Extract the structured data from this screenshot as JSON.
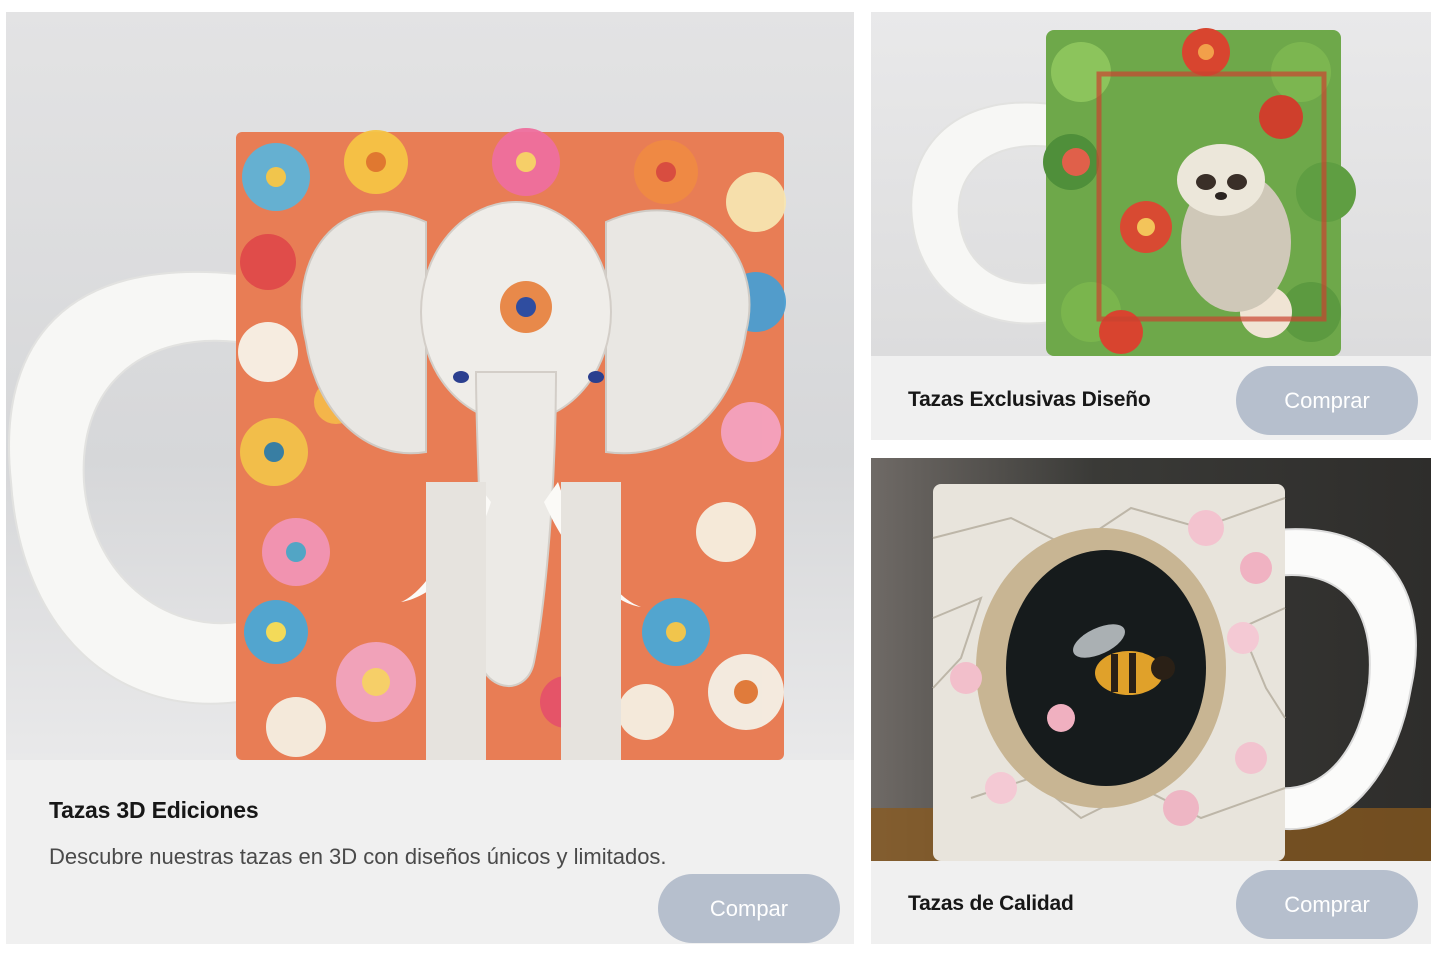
{
  "products": [
    {
      "title": "Tazas 3D Ediciones",
      "description": "Descubre nuestras tazas en 3D con diseños únicos y limitados.",
      "button_label": "Compar",
      "image_subject": "white-mug-3d-elephant-flowers"
    },
    {
      "title": "Tazas Exclusivas Diseño",
      "button_label": "Comprar",
      "image_subject": "white-mug-3d-sloth-jungle"
    },
    {
      "title": "Tazas de Calidad",
      "button_label": "Comprar",
      "image_subject": "white-mug-3d-bee-cracked-wall"
    }
  ],
  "colors": {
    "card_background": "#f0f0f0",
    "button_background": "#b6bfcd",
    "button_text": "#ffffff",
    "title_text": "#171717",
    "description_text": "#4a4a4a"
  }
}
